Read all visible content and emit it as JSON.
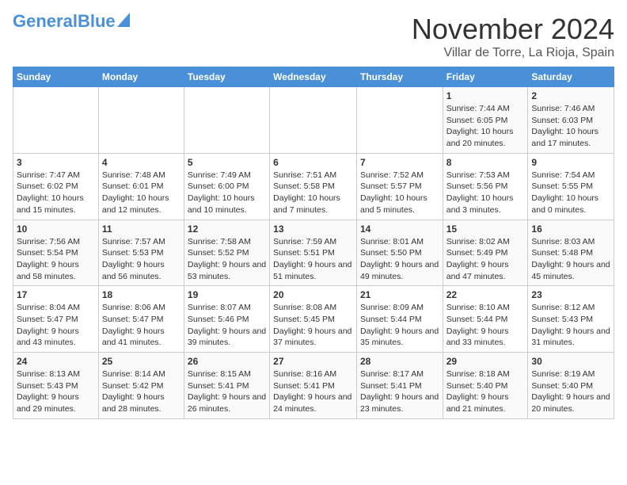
{
  "logo": {
    "part1": "General",
    "part2": "Blue"
  },
  "header": {
    "month": "November 2024",
    "location": "Villar de Torre, La Rioja, Spain"
  },
  "weekdays": [
    "Sunday",
    "Monday",
    "Tuesday",
    "Wednesday",
    "Thursday",
    "Friday",
    "Saturday"
  ],
  "weeks": [
    [
      {
        "day": "",
        "info": ""
      },
      {
        "day": "",
        "info": ""
      },
      {
        "day": "",
        "info": ""
      },
      {
        "day": "",
        "info": ""
      },
      {
        "day": "",
        "info": ""
      },
      {
        "day": "1",
        "info": "Sunrise: 7:44 AM\nSunset: 6:05 PM\nDaylight: 10 hours and 20 minutes."
      },
      {
        "day": "2",
        "info": "Sunrise: 7:46 AM\nSunset: 6:03 PM\nDaylight: 10 hours and 17 minutes."
      }
    ],
    [
      {
        "day": "3",
        "info": "Sunrise: 7:47 AM\nSunset: 6:02 PM\nDaylight: 10 hours and 15 minutes."
      },
      {
        "day": "4",
        "info": "Sunrise: 7:48 AM\nSunset: 6:01 PM\nDaylight: 10 hours and 12 minutes."
      },
      {
        "day": "5",
        "info": "Sunrise: 7:49 AM\nSunset: 6:00 PM\nDaylight: 10 hours and 10 minutes."
      },
      {
        "day": "6",
        "info": "Sunrise: 7:51 AM\nSunset: 5:58 PM\nDaylight: 10 hours and 7 minutes."
      },
      {
        "day": "7",
        "info": "Sunrise: 7:52 AM\nSunset: 5:57 PM\nDaylight: 10 hours and 5 minutes."
      },
      {
        "day": "8",
        "info": "Sunrise: 7:53 AM\nSunset: 5:56 PM\nDaylight: 10 hours and 3 minutes."
      },
      {
        "day": "9",
        "info": "Sunrise: 7:54 AM\nSunset: 5:55 PM\nDaylight: 10 hours and 0 minutes."
      }
    ],
    [
      {
        "day": "10",
        "info": "Sunrise: 7:56 AM\nSunset: 5:54 PM\nDaylight: 9 hours and 58 minutes."
      },
      {
        "day": "11",
        "info": "Sunrise: 7:57 AM\nSunset: 5:53 PM\nDaylight: 9 hours and 56 minutes."
      },
      {
        "day": "12",
        "info": "Sunrise: 7:58 AM\nSunset: 5:52 PM\nDaylight: 9 hours and 53 minutes."
      },
      {
        "day": "13",
        "info": "Sunrise: 7:59 AM\nSunset: 5:51 PM\nDaylight: 9 hours and 51 minutes."
      },
      {
        "day": "14",
        "info": "Sunrise: 8:01 AM\nSunset: 5:50 PM\nDaylight: 9 hours and 49 minutes."
      },
      {
        "day": "15",
        "info": "Sunrise: 8:02 AM\nSunset: 5:49 PM\nDaylight: 9 hours and 47 minutes."
      },
      {
        "day": "16",
        "info": "Sunrise: 8:03 AM\nSunset: 5:48 PM\nDaylight: 9 hours and 45 minutes."
      }
    ],
    [
      {
        "day": "17",
        "info": "Sunrise: 8:04 AM\nSunset: 5:47 PM\nDaylight: 9 hours and 43 minutes."
      },
      {
        "day": "18",
        "info": "Sunrise: 8:06 AM\nSunset: 5:47 PM\nDaylight: 9 hours and 41 minutes."
      },
      {
        "day": "19",
        "info": "Sunrise: 8:07 AM\nSunset: 5:46 PM\nDaylight: 9 hours and 39 minutes."
      },
      {
        "day": "20",
        "info": "Sunrise: 8:08 AM\nSunset: 5:45 PM\nDaylight: 9 hours and 37 minutes."
      },
      {
        "day": "21",
        "info": "Sunrise: 8:09 AM\nSunset: 5:44 PM\nDaylight: 9 hours and 35 minutes."
      },
      {
        "day": "22",
        "info": "Sunrise: 8:10 AM\nSunset: 5:44 PM\nDaylight: 9 hours and 33 minutes."
      },
      {
        "day": "23",
        "info": "Sunrise: 8:12 AM\nSunset: 5:43 PM\nDaylight: 9 hours and 31 minutes."
      }
    ],
    [
      {
        "day": "24",
        "info": "Sunrise: 8:13 AM\nSunset: 5:43 PM\nDaylight: 9 hours and 29 minutes."
      },
      {
        "day": "25",
        "info": "Sunrise: 8:14 AM\nSunset: 5:42 PM\nDaylight: 9 hours and 28 minutes."
      },
      {
        "day": "26",
        "info": "Sunrise: 8:15 AM\nSunset: 5:41 PM\nDaylight: 9 hours and 26 minutes."
      },
      {
        "day": "27",
        "info": "Sunrise: 8:16 AM\nSunset: 5:41 PM\nDaylight: 9 hours and 24 minutes."
      },
      {
        "day": "28",
        "info": "Sunrise: 8:17 AM\nSunset: 5:41 PM\nDaylight: 9 hours and 23 minutes."
      },
      {
        "day": "29",
        "info": "Sunrise: 8:18 AM\nSunset: 5:40 PM\nDaylight: 9 hours and 21 minutes."
      },
      {
        "day": "30",
        "info": "Sunrise: 8:19 AM\nSunset: 5:40 PM\nDaylight: 9 hours and 20 minutes."
      }
    ]
  ]
}
